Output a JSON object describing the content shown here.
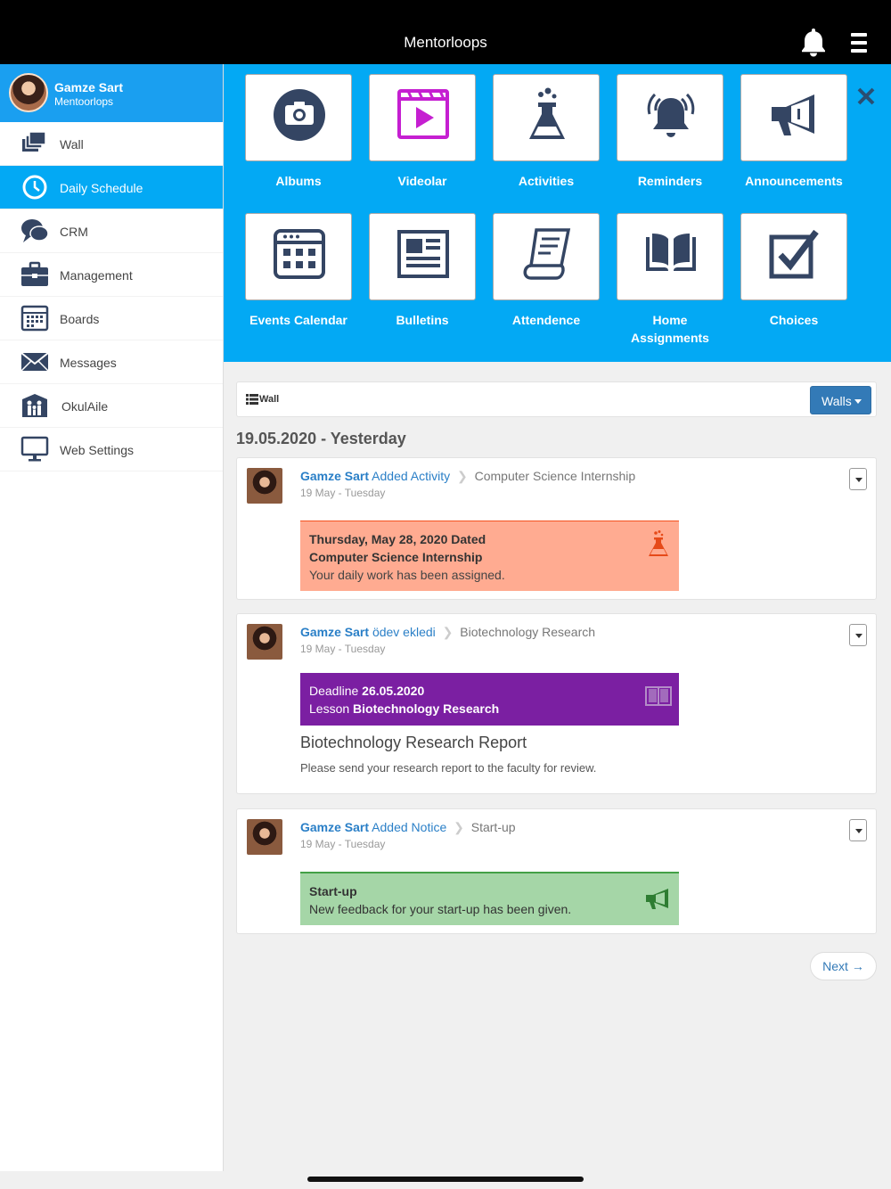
{
  "app": {
    "title": "Mentorloops"
  },
  "profile": {
    "name": "Gamze Sart",
    "org": "Mentoorlops"
  },
  "sidebar": {
    "items": [
      {
        "label": "Wall",
        "icon": "wall-icon"
      },
      {
        "label": "Daily Schedule",
        "icon": "clock-icon",
        "active": true
      },
      {
        "label": "CRM",
        "icon": "crm-icon"
      },
      {
        "label": "Management",
        "icon": "briefcase-icon"
      },
      {
        "label": "Boards",
        "icon": "board-icon"
      },
      {
        "label": "Messages",
        "icon": "envelope-icon"
      },
      {
        "label": "OkulAile",
        "icon": "family-icon"
      },
      {
        "label": "Web Settings",
        "icon": "monitor-icon"
      }
    ]
  },
  "quick_menu": {
    "tiles": [
      {
        "label": "Albums",
        "icon": "camera-icon"
      },
      {
        "label": "Videolar",
        "icon": "video-icon"
      },
      {
        "label": "Activities",
        "icon": "flask-icon"
      },
      {
        "label": "Reminders",
        "icon": "alarm-icon"
      },
      {
        "label": "Announcements",
        "icon": "megaphone-icon"
      },
      {
        "label": "Events Calendar",
        "icon": "calendar-icon"
      },
      {
        "label": "Bulletins",
        "icon": "newspaper-icon"
      },
      {
        "label": "Attendence",
        "icon": "scroll-icon"
      },
      {
        "label": "Home Assignments",
        "icon": "book-icon"
      },
      {
        "label": "Choices",
        "icon": "checkbox-icon"
      }
    ]
  },
  "wall": {
    "label": "Wall",
    "walls_button": "Walls"
  },
  "date_heading": "19.05.2020 - Yesterday",
  "posts": [
    {
      "author": "Gamze Sart",
      "action": "Added Activity",
      "context": "Computer Science Internship",
      "time": "19 May - Tuesday",
      "card_line1": "Thursday, May 28, 2020 Dated",
      "card_line2": "Computer Science Internship",
      "card_line3": "Your daily work has been assigned.",
      "card_color": "#ffab91",
      "card_border": "#f4511e",
      "icon": "flask-icon"
    },
    {
      "author": "Gamze Sart",
      "action": "ödev ekledi",
      "context": "Biotechnology Research",
      "time": "19 May - Tuesday",
      "deadline_label": "Deadline",
      "deadline": "26.05.2020",
      "lesson_label": "Lesson",
      "lesson": "Biotechnology Research",
      "card_color": "#7b1fa2",
      "title": "Biotechnology Research Report",
      "description": "Please send your research report to the faculty for review.",
      "icon": "book-icon"
    },
    {
      "author": "Gamze Sart",
      "action": "Added Notice",
      "context": "Start-up",
      "time": "19 May - Tuesday",
      "card_title": "Start-up",
      "card_text": "New feedback for your start-up has been given.",
      "card_color": "#a5d6a7",
      "card_border": "#43a047",
      "icon": "megaphone-icon"
    }
  ],
  "pagination": {
    "next_label": "Next →"
  }
}
